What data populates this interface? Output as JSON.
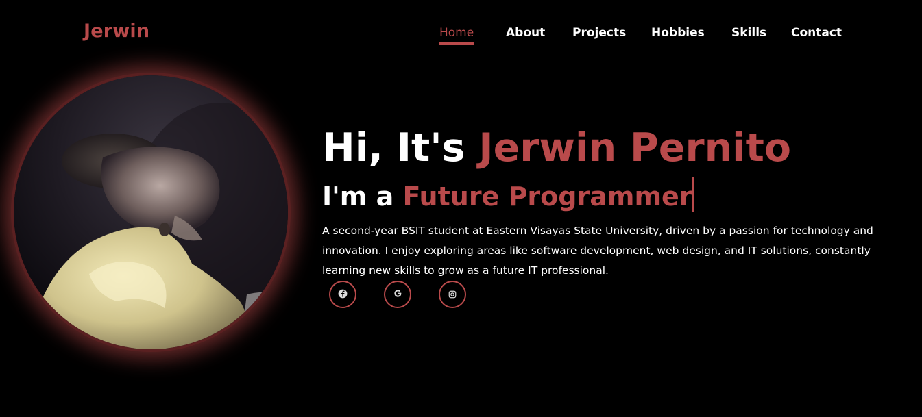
{
  "logo": "Jerwin",
  "nav": {
    "items": [
      "Home",
      "About",
      "Projects",
      "Hobbies",
      "Skills",
      "Contact"
    ],
    "active": "Home"
  },
  "hero": {
    "greeting": "Hi, It's ",
    "name": "Jerwin Pernito",
    "role_prefix": "I'm a ",
    "role": "Future Programmer",
    "bio": "A second-year BSIT student at Eastern Visayas State University, driven by a passion for technology and innovation. I enjoy exploring areas like software development, web design, and IT solutions, constantly learning new skills to grow as a future IT professional."
  },
  "social": [
    {
      "icon": "facebook-icon"
    },
    {
      "icon": "google-icon"
    },
    {
      "icon": "instagram-icon"
    }
  ],
  "colors": {
    "accent": "#b94a4b",
    "background": "#000000",
    "text": "#ffffff"
  }
}
